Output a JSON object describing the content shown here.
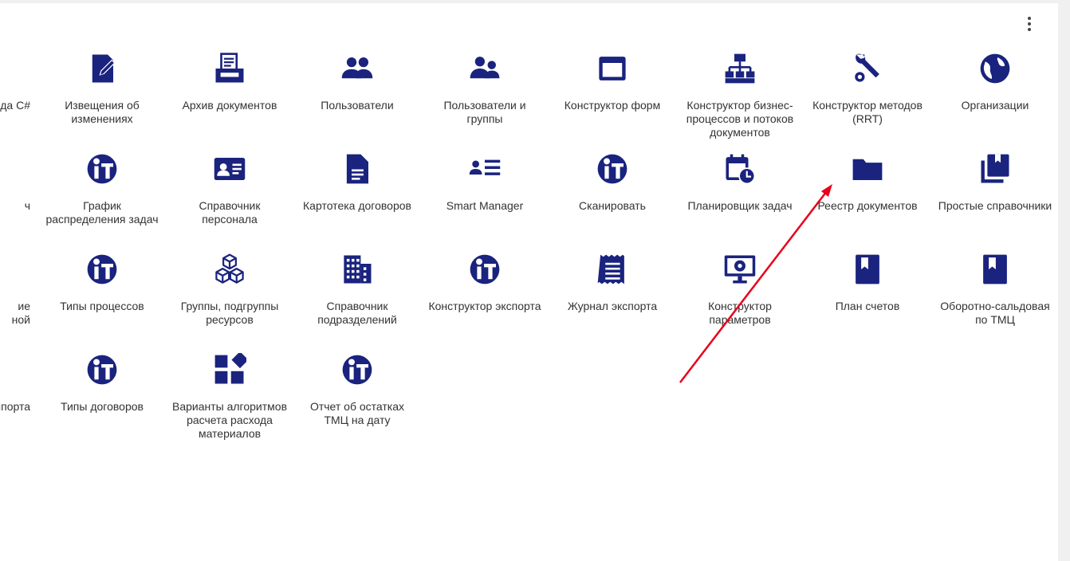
{
  "menu_icon": "more-vert-icon",
  "accent_color": "#1a237e",
  "annotation_color": "#e8001c",
  "clipped_column": [
    {
      "label": "да C#",
      "icon": "none"
    },
    {
      "label": "ч",
      "icon": "none"
    },
    {
      "label": "ие\nной",
      "icon": "none"
    },
    {
      "label": "нпорта",
      "icon": "none"
    }
  ],
  "tiles": [
    {
      "label": "Извещения об изменениях",
      "icon": "edit-document-icon"
    },
    {
      "label": "Архив документов",
      "icon": "archive-printer-icon"
    },
    {
      "label": "Пользователи",
      "icon": "users-icon"
    },
    {
      "label": "Пользователи и группы",
      "icon": "users-groups-icon"
    },
    {
      "label": "Конструктор форм",
      "icon": "window-icon"
    },
    {
      "label": "Конструктор бизнес-процессов и потоков документов",
      "icon": "sitemap-icon"
    },
    {
      "label": "Конструктор методов (RRT)",
      "icon": "wrench-gear-icon"
    },
    {
      "label": "Организации",
      "icon": "globe-icon"
    },
    {
      "label": "График распределения задач",
      "icon": "it-logo-icon"
    },
    {
      "label": "Справочник персонала",
      "icon": "id-card-icon"
    },
    {
      "label": "Картотека договоров",
      "icon": "document-icon"
    },
    {
      "label": "Smart Manager",
      "icon": "person-list-icon"
    },
    {
      "label": "Сканировать",
      "icon": "it-logo-icon"
    },
    {
      "label": "Планировщик задач",
      "icon": "calendar-clock-icon"
    },
    {
      "label": "Реестр документов",
      "icon": "folder-icon"
    },
    {
      "label": "Простые справочники",
      "icon": "books-icon"
    },
    {
      "label": "Типы процессов",
      "icon": "it-logo-icon"
    },
    {
      "label": "Группы, подгруппы ресурсов",
      "icon": "cubes-icon"
    },
    {
      "label": "Справочник подразделений",
      "icon": "building-icon"
    },
    {
      "label": "Конструктор экспорта",
      "icon": "it-logo-icon"
    },
    {
      "label": "Журнал экспорта",
      "icon": "receipt-icon"
    },
    {
      "label": "Конструктор параметров",
      "icon": "monitor-gear-icon"
    },
    {
      "label": "План счетов",
      "icon": "bookmark-book-icon"
    },
    {
      "label": "Оборотно-сальдовая по ТМЦ",
      "icon": "bookmark-book-icon"
    },
    {
      "label": "Типы договоров",
      "icon": "it-logo-icon"
    },
    {
      "label": "Варианты алгоритмов расчета расхода материалов",
      "icon": "widgets-icon"
    },
    {
      "label": "Отчет об остатках ТМЦ на дату",
      "icon": "it-logo-icon"
    }
  ]
}
